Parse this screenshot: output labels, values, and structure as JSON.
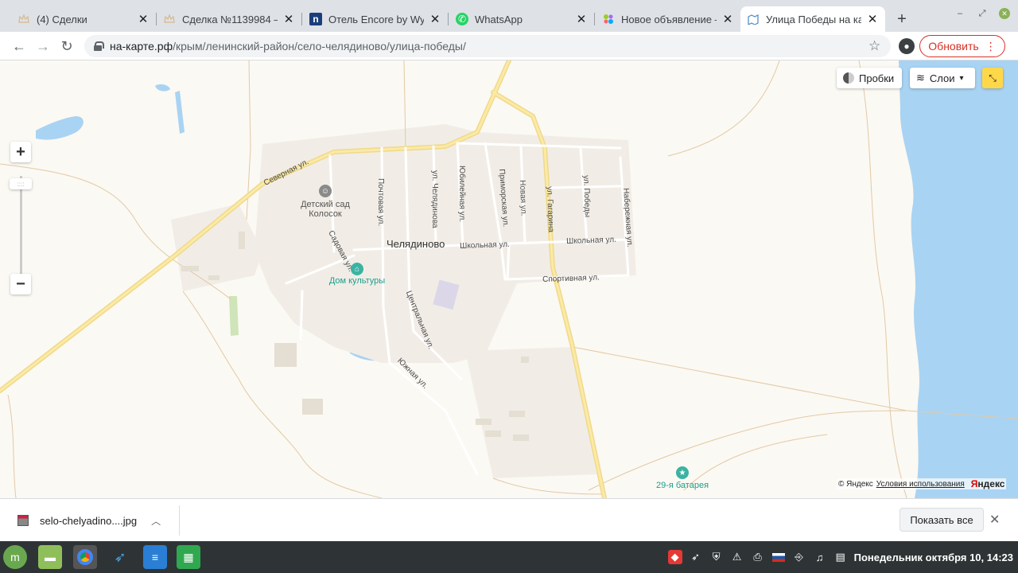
{
  "browser": {
    "tabs": [
      {
        "title": "(4) Сделки",
        "icon": "crown-icon",
        "active": false
      },
      {
        "title": "Сделка №1139984 —",
        "icon": "crown-icon",
        "active": false
      },
      {
        "title": "Отель Encore by Wynd",
        "icon": "n-logo-icon",
        "active": false
      },
      {
        "title": "WhatsApp",
        "icon": "whatsapp-icon",
        "active": false
      },
      {
        "title": "Новое объявление —",
        "icon": "avito-icon",
        "active": false
      },
      {
        "title": "Улица Победы на кар",
        "icon": "map-icon",
        "active": true
      }
    ],
    "url_host": "на-карте.рф",
    "url_path": "/крым/ленинский-район/село-челядиново/улица-победы/",
    "update_label": "Обновить"
  },
  "map": {
    "town": "Челядиново",
    "controls": {
      "traffic_label": "Пробки",
      "layers_label": "Слои"
    },
    "streets": [
      {
        "name": "Северная ул."
      },
      {
        "name": "Почтовая ул."
      },
      {
        "name": "ул. Челядинова"
      },
      {
        "name": "Юбилейная ул."
      },
      {
        "name": "Приморская ул."
      },
      {
        "name": "Новая ул."
      },
      {
        "name": "ул. Гагарина"
      },
      {
        "name": "ул. Победы"
      },
      {
        "name": "Набережная ул."
      },
      {
        "name": "Школьная ул."
      },
      {
        "name": "Школьная ул."
      },
      {
        "name": "Садовая ул."
      },
      {
        "name": "Спортивная ул."
      },
      {
        "name": "Центральная ул."
      },
      {
        "name": "Южная ул."
      }
    ],
    "pois": {
      "kindergarten_line1": "Детский сад",
      "kindergarten_line2": "Колосок",
      "culture_house": "Дом культуры",
      "battery": "29-я батарея"
    },
    "copyright": {
      "owner": "© Яндекс",
      "terms": "Условия использования",
      "brand_first": "Я",
      "brand_rest": "ндекс"
    }
  },
  "downloads": {
    "file_name": "selo-chelyadino....jpg",
    "show_all": "Показать все"
  },
  "taskbar": {
    "clock": "Понедельник октября 10, 14:23"
  }
}
